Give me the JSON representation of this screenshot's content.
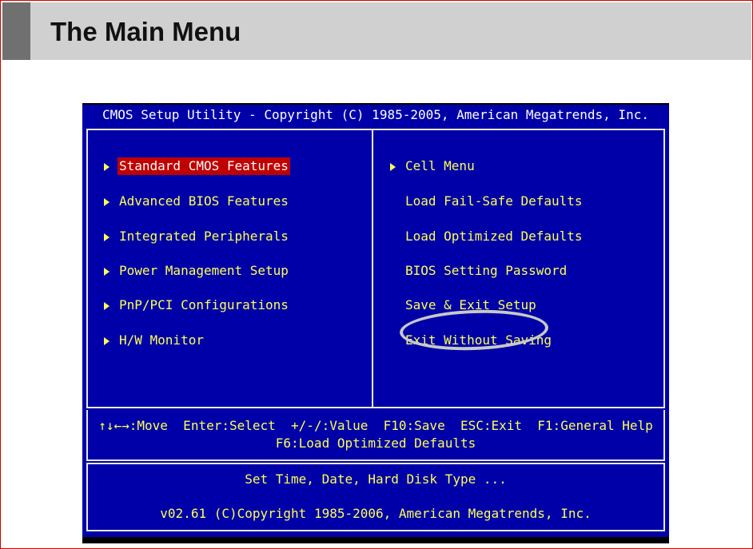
{
  "slide": {
    "title": "The Main Menu"
  },
  "bios": {
    "title": "CMOS Setup Utility - Copyright (C) 1985-2005, American Megatrends, Inc.",
    "left_menu": [
      {
        "label": "Standard CMOS Features",
        "selected": true
      },
      {
        "label": "Advanced BIOS Features"
      },
      {
        "label": "Integrated Peripherals"
      },
      {
        "label": "Power Management Setup"
      },
      {
        "label": "PnP/PCI Configurations"
      },
      {
        "label": "H/W Monitor"
      }
    ],
    "right_menu": [
      {
        "label": "Cell Menu",
        "has_arrow": true
      },
      {
        "label": "Load Fail-Safe Defaults"
      },
      {
        "label": "Load Optimized Defaults"
      },
      {
        "label": "BIOS Setting Password"
      },
      {
        "label": "Save & Exit Setup",
        "annotated": true
      },
      {
        "label": "Exit Without Saving"
      }
    ],
    "keys": {
      "line1": "↑↓←→:Move  Enter:Select  +/-/:Value  F10:Save  ESC:Exit  F1:General Help",
      "line2": "F6:Load Optimized Defaults"
    },
    "status": {
      "help": "Set Time, Date, Hard Disk Type ...",
      "version": "v02.61 (C)Copyright 1985-2006, American Megatrends, Inc."
    },
    "colors": {
      "background": "#0000a8",
      "text": "#ffff55",
      "highlight": "#c00000",
      "border": "#e8e8e8"
    },
    "icons": {
      "menu_arrow": "right-triangle-icon"
    }
  }
}
